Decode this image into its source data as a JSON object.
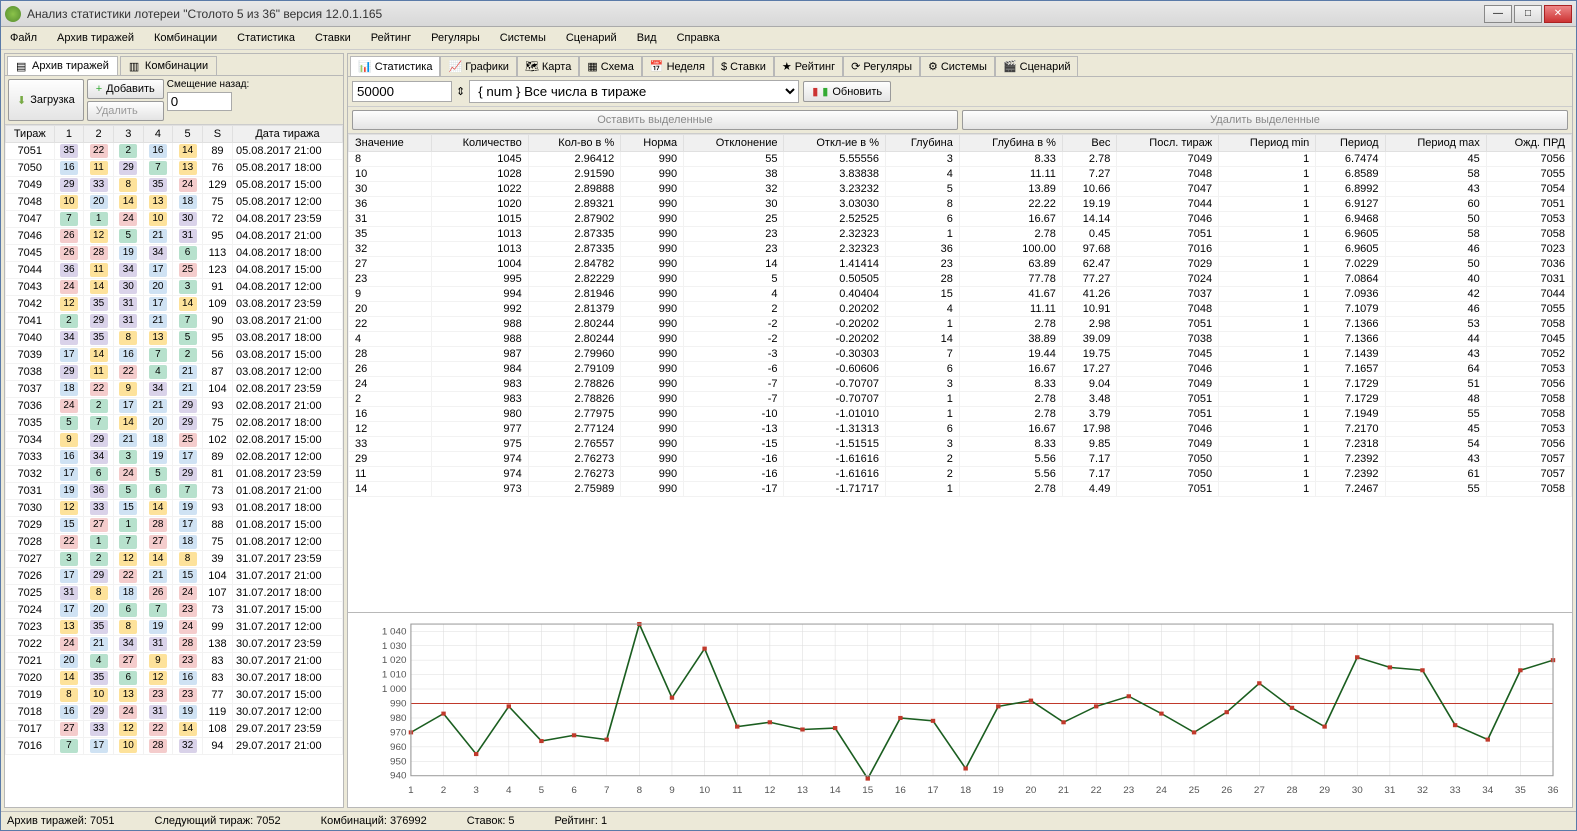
{
  "window": {
    "title": "Анализ статистики лотереи \"Столото 5 из 36\" версия 12.0.1.165"
  },
  "menu": [
    "Файл",
    "Архив тиражей",
    "Комбинации",
    "Статистика",
    "Ставки",
    "Рейтинг",
    "Регуляры",
    "Системы",
    "Сценарий",
    "Вид",
    "Справка"
  ],
  "leftTabs": {
    "archive": "Архив тиражей",
    "comb": "Комбинации"
  },
  "leftToolbar": {
    "load": "Загрузка",
    "add": "Добавить",
    "delete": "Удалить",
    "offsetLabel": "Смещение назад:",
    "offset": "0"
  },
  "archiveHeaders": [
    "Тираж",
    "1",
    "2",
    "3",
    "4",
    "5",
    "S",
    "Дата тиража"
  ],
  "archive": [
    {
      "t": 7051,
      "n": [
        35,
        22,
        2,
        16,
        14
      ],
      "s": 89,
      "d": "05.08.2017 21:00"
    },
    {
      "t": 7050,
      "n": [
        16,
        11,
        29,
        7,
        13
      ],
      "s": 76,
      "d": "05.08.2017 18:00"
    },
    {
      "t": 7049,
      "n": [
        29,
        33,
        8,
        35,
        24
      ],
      "s": 129,
      "d": "05.08.2017 15:00"
    },
    {
      "t": 7048,
      "n": [
        10,
        20,
        14,
        13,
        18
      ],
      "s": 75,
      "d": "05.08.2017 12:00"
    },
    {
      "t": 7047,
      "n": [
        7,
        1,
        24,
        10,
        30
      ],
      "s": 72,
      "d": "04.08.2017 23:59"
    },
    {
      "t": 7046,
      "n": [
        26,
        12,
        5,
        21,
        31
      ],
      "s": 95,
      "d": "04.08.2017 21:00"
    },
    {
      "t": 7045,
      "n": [
        26,
        28,
        19,
        34,
        6
      ],
      "s": 113,
      "d": "04.08.2017 18:00"
    },
    {
      "t": 7044,
      "n": [
        36,
        11,
        34,
        17,
        25
      ],
      "s": 123,
      "d": "04.08.2017 15:00"
    },
    {
      "t": 7043,
      "n": [
        24,
        14,
        30,
        20,
        3
      ],
      "s": 91,
      "d": "04.08.2017 12:00"
    },
    {
      "t": 7042,
      "n": [
        12,
        35,
        31,
        17,
        14
      ],
      "s": 109,
      "d": "03.08.2017 23:59"
    },
    {
      "t": 7041,
      "n": [
        2,
        29,
        31,
        21,
        7
      ],
      "s": 90,
      "d": "03.08.2017 21:00"
    },
    {
      "t": 7040,
      "n": [
        34,
        35,
        8,
        13,
        5
      ],
      "s": 95,
      "d": "03.08.2017 18:00"
    },
    {
      "t": 7039,
      "n": [
        17,
        14,
        16,
        7,
        2
      ],
      "s": 56,
      "d": "03.08.2017 15:00"
    },
    {
      "t": 7038,
      "n": [
        29,
        11,
        22,
        4,
        21
      ],
      "s": 87,
      "d": "03.08.2017 12:00"
    },
    {
      "t": 7037,
      "n": [
        18,
        22,
        9,
        34,
        21
      ],
      "s": 104,
      "d": "02.08.2017 23:59"
    },
    {
      "t": 7036,
      "n": [
        24,
        2,
        17,
        21,
        29
      ],
      "s": 93,
      "d": "02.08.2017 21:00"
    },
    {
      "t": 7035,
      "n": [
        5,
        7,
        14,
        20,
        29
      ],
      "s": 75,
      "d": "02.08.2017 18:00"
    },
    {
      "t": 7034,
      "n": [
        9,
        29,
        21,
        18,
        25
      ],
      "s": 102,
      "d": "02.08.2017 15:00"
    },
    {
      "t": 7033,
      "n": [
        16,
        34,
        3,
        19,
        17
      ],
      "s": 89,
      "d": "02.08.2017 12:00"
    },
    {
      "t": 7032,
      "n": [
        17,
        6,
        24,
        5,
        29
      ],
      "s": 81,
      "d": "01.08.2017 23:59"
    },
    {
      "t": 7031,
      "n": [
        19,
        36,
        5,
        6,
        7
      ],
      "s": 73,
      "d": "01.08.2017 21:00"
    },
    {
      "t": 7030,
      "n": [
        12,
        33,
        15,
        14,
        19
      ],
      "s": 93,
      "d": "01.08.2017 18:00"
    },
    {
      "t": 7029,
      "n": [
        15,
        27,
        1,
        28,
        17
      ],
      "s": 88,
      "d": "01.08.2017 15:00"
    },
    {
      "t": 7028,
      "n": [
        22,
        1,
        7,
        27,
        18
      ],
      "s": 75,
      "d": "01.08.2017 12:00"
    },
    {
      "t": 7027,
      "n": [
        3,
        2,
        12,
        14,
        8
      ],
      "s": 39,
      "d": "31.07.2017 23:59"
    },
    {
      "t": 7026,
      "n": [
        17,
        29,
        22,
        21,
        15
      ],
      "s": 104,
      "d": "31.07.2017 21:00"
    },
    {
      "t": 7025,
      "n": [
        31,
        8,
        18,
        26,
        24
      ],
      "s": 107,
      "d": "31.07.2017 18:00"
    },
    {
      "t": 7024,
      "n": [
        17,
        20,
        6,
        7,
        23
      ],
      "s": 73,
      "d": "31.07.2017 15:00"
    },
    {
      "t": 7023,
      "n": [
        13,
        35,
        8,
        19,
        24
      ],
      "s": 99,
      "d": "31.07.2017 12:00"
    },
    {
      "t": 7022,
      "n": [
        24,
        21,
        34,
        31,
        28
      ],
      "s": 138,
      "d": "30.07.2017 23:59"
    },
    {
      "t": 7021,
      "n": [
        20,
        4,
        27,
        9,
        23
      ],
      "s": 83,
      "d": "30.07.2017 21:00"
    },
    {
      "t": 7020,
      "n": [
        14,
        35,
        6,
        12,
        16
      ],
      "s": 83,
      "d": "30.07.2017 18:00"
    },
    {
      "t": 7019,
      "n": [
        8,
        10,
        13,
        23,
        23
      ],
      "s": 77,
      "d": "30.07.2017 15:00"
    },
    {
      "t": 7018,
      "n": [
        16,
        29,
        24,
        31,
        19
      ],
      "s": 119,
      "d": "30.07.2017 12:00"
    },
    {
      "t": 7017,
      "n": [
        27,
        33,
        12,
        22,
        14
      ],
      "s": 108,
      "d": "29.07.2017 23:59"
    },
    {
      "t": 7016,
      "n": [
        7,
        17,
        10,
        28,
        32
      ],
      "s": 94,
      "d": "29.07.2017 21:00"
    }
  ],
  "rightTabs": [
    "Статистика",
    "Графики",
    "Карта",
    "Схема",
    "Неделя",
    "Ставки",
    "Рейтинг",
    "Регуляры",
    "Системы",
    "Сценарий"
  ],
  "statToolbar": {
    "spin": "50000",
    "combo": "{ num } Все числа в тираже",
    "refresh": "Обновить",
    "keep": "Оставить выделенные",
    "del": "Удалить выделенные"
  },
  "statHeaders": [
    "Значение",
    "Количество",
    "Кол-во в %",
    "Норма",
    "Отклонение",
    "Откл-ие в %",
    "Глубина",
    "Глубина в %",
    "Вес",
    "Посл. тираж",
    "Период min",
    "Период",
    "Период max",
    "Ожд. ПРД"
  ],
  "stats": [
    {
      "v": 8,
      "c": 1045,
      "p": "2.96412",
      "n": 990,
      "d": 55,
      "dp": "5.55556",
      "g": 3,
      "gp": "8.33",
      "w": "2.78",
      "lt": 7049,
      "pmin": 1,
      "per": "6.7474",
      "pmax": 45,
      "eprd": 7056
    },
    {
      "v": 10,
      "c": 1028,
      "p": "2.91590",
      "n": 990,
      "d": 38,
      "dp": "3.83838",
      "g": 4,
      "gp": "11.11",
      "w": "7.27",
      "lt": 7048,
      "pmin": 1,
      "per": "6.8589",
      "pmax": 58,
      "eprd": 7055
    },
    {
      "v": 30,
      "c": 1022,
      "p": "2.89888",
      "n": 990,
      "d": 32,
      "dp": "3.23232",
      "g": 5,
      "gp": "13.89",
      "w": "10.66",
      "lt": 7047,
      "pmin": 1,
      "per": "6.8992",
      "pmax": 43,
      "eprd": 7054
    },
    {
      "v": 36,
      "c": 1020,
      "p": "2.89321",
      "n": 990,
      "d": 30,
      "dp": "3.03030",
      "g": 8,
      "gp": "22.22",
      "w": "19.19",
      "lt": 7044,
      "pmin": 1,
      "per": "6.9127",
      "pmax": 60,
      "eprd": 7051
    },
    {
      "v": 31,
      "c": 1015,
      "p": "2.87902",
      "n": 990,
      "d": 25,
      "dp": "2.52525",
      "g": 6,
      "gp": "16.67",
      "w": "14.14",
      "lt": 7046,
      "pmin": 1,
      "per": "6.9468",
      "pmax": 50,
      "eprd": 7053
    },
    {
      "v": 35,
      "c": 1013,
      "p": "2.87335",
      "n": 990,
      "d": 23,
      "dp": "2.32323",
      "g": 1,
      "gp": "2.78",
      "w": "0.45",
      "lt": 7051,
      "pmin": 1,
      "per": "6.9605",
      "pmax": 58,
      "eprd": 7058
    },
    {
      "v": 32,
      "c": 1013,
      "p": "2.87335",
      "n": 990,
      "d": 23,
      "dp": "2.32323",
      "g": 36,
      "gp": "100.00",
      "w": "97.68",
      "lt": 7016,
      "pmin": 1,
      "per": "6.9605",
      "pmax": 46,
      "eprd": 7023
    },
    {
      "v": 27,
      "c": 1004,
      "p": "2.84782",
      "n": 990,
      "d": 14,
      "dp": "1.41414",
      "g": 23,
      "gp": "63.89",
      "w": "62.47",
      "lt": 7029,
      "pmin": 1,
      "per": "7.0229",
      "pmax": 50,
      "eprd": 7036
    },
    {
      "v": 23,
      "c": 995,
      "p": "2.82229",
      "n": 990,
      "d": 5,
      "dp": "0.50505",
      "g": 28,
      "gp": "77.78",
      "w": "77.27",
      "lt": 7024,
      "pmin": 1,
      "per": "7.0864",
      "pmax": 40,
      "eprd": 7031
    },
    {
      "v": 9,
      "c": 994,
      "p": "2.81946",
      "n": 990,
      "d": 4,
      "dp": "0.40404",
      "g": 15,
      "gp": "41.67",
      "w": "41.26",
      "lt": 7037,
      "pmin": 1,
      "per": "7.0936",
      "pmax": 42,
      "eprd": 7044
    },
    {
      "v": 20,
      "c": 992,
      "p": "2.81379",
      "n": 990,
      "d": 2,
      "dp": "0.20202",
      "g": 4,
      "gp": "11.11",
      "w": "10.91",
      "lt": 7048,
      "pmin": 1,
      "per": "7.1079",
      "pmax": 46,
      "eprd": 7055
    },
    {
      "v": 22,
      "c": 988,
      "p": "2.80244",
      "n": 990,
      "d": -2,
      "dp": "-0.20202",
      "g": 1,
      "gp": "2.78",
      "w": "2.98",
      "lt": 7051,
      "pmin": 1,
      "per": "7.1366",
      "pmax": 53,
      "eprd": 7058
    },
    {
      "v": 4,
      "c": 988,
      "p": "2.80244",
      "n": 990,
      "d": -2,
      "dp": "-0.20202",
      "g": 14,
      "gp": "38.89",
      "w": "39.09",
      "lt": 7038,
      "pmin": 1,
      "per": "7.1366",
      "pmax": 44,
      "eprd": 7045
    },
    {
      "v": 28,
      "c": 987,
      "p": "2.79960",
      "n": 990,
      "d": -3,
      "dp": "-0.30303",
      "g": 7,
      "gp": "19.44",
      "w": "19.75",
      "lt": 7045,
      "pmin": 1,
      "per": "7.1439",
      "pmax": 43,
      "eprd": 7052
    },
    {
      "v": 26,
      "c": 984,
      "p": "2.79109",
      "n": 990,
      "d": -6,
      "dp": "-0.60606",
      "g": 6,
      "gp": "16.67",
      "w": "17.27",
      "lt": 7046,
      "pmin": 1,
      "per": "7.1657",
      "pmax": 64,
      "eprd": 7053
    },
    {
      "v": 24,
      "c": 983,
      "p": "2.78826",
      "n": 990,
      "d": -7,
      "dp": "-0.70707",
      "g": 3,
      "gp": "8.33",
      "w": "9.04",
      "lt": 7049,
      "pmin": 1,
      "per": "7.1729",
      "pmax": 51,
      "eprd": 7056
    },
    {
      "v": 2,
      "c": 983,
      "p": "2.78826",
      "n": 990,
      "d": -7,
      "dp": "-0.70707",
      "g": 1,
      "gp": "2.78",
      "w": "3.48",
      "lt": 7051,
      "pmin": 1,
      "per": "7.1729",
      "pmax": 48,
      "eprd": 7058
    },
    {
      "v": 16,
      "c": 980,
      "p": "2.77975",
      "n": 990,
      "d": -10,
      "dp": "-1.01010",
      "g": 1,
      "gp": "2.78",
      "w": "3.79",
      "lt": 7051,
      "pmin": 1,
      "per": "7.1949",
      "pmax": 55,
      "eprd": 7058
    },
    {
      "v": 12,
      "c": 977,
      "p": "2.77124",
      "n": 990,
      "d": -13,
      "dp": "-1.31313",
      "g": 6,
      "gp": "16.67",
      "w": "17.98",
      "lt": 7046,
      "pmin": 1,
      "per": "7.2170",
      "pmax": 45,
      "eprd": 7053
    },
    {
      "v": 33,
      "c": 975,
      "p": "2.76557",
      "n": 990,
      "d": -15,
      "dp": "-1.51515",
      "g": 3,
      "gp": "8.33",
      "w": "9.85",
      "lt": 7049,
      "pmin": 1,
      "per": "7.2318",
      "pmax": 54,
      "eprd": 7056
    },
    {
      "v": 29,
      "c": 974,
      "p": "2.76273",
      "n": 990,
      "d": -16,
      "dp": "-1.61616",
      "g": 2,
      "gp": "5.56",
      "w": "7.17",
      "lt": 7050,
      "pmin": 1,
      "per": "7.2392",
      "pmax": 43,
      "eprd": 7057
    },
    {
      "v": 11,
      "c": 974,
      "p": "2.76273",
      "n": 990,
      "d": -16,
      "dp": "-1.61616",
      "g": 2,
      "gp": "5.56",
      "w": "7.17",
      "lt": 7050,
      "pmin": 1,
      "per": "7.2392",
      "pmax": 61,
      "eprd": 7057
    },
    {
      "v": 14,
      "c": 973,
      "p": "2.75989",
      "n": 990,
      "d": -17,
      "dp": "-1.71717",
      "g": 1,
      "gp": "2.78",
      "w": "4.49",
      "lt": 7051,
      "pmin": 1,
      "per": "7.2467",
      "pmax": 55,
      "eprd": 7058
    }
  ],
  "status": {
    "archive": "Архив тиражей: 7051",
    "next": "Следующий тираж: 7052",
    "comb": "Комбинаций: 376992",
    "bets": "Ставок: 5",
    "rating": "Рейтинг: 1"
  },
  "chart_data": {
    "type": "line",
    "categories": [
      1,
      2,
      3,
      4,
      5,
      6,
      7,
      8,
      9,
      10,
      11,
      12,
      13,
      14,
      15,
      16,
      17,
      18,
      19,
      20,
      21,
      22,
      23,
      24,
      25,
      26,
      27,
      28,
      29,
      30,
      31,
      32,
      33,
      34,
      35,
      36
    ],
    "values": [
      970,
      983,
      955,
      988,
      964,
      968,
      965,
      1045,
      994,
      1028,
      974,
      977,
      972,
      973,
      938,
      980,
      978,
      945,
      988,
      992,
      977,
      988,
      995,
      983,
      970,
      984,
      1004,
      987,
      974,
      1022,
      1015,
      1013,
      975,
      965,
      1013,
      1020
    ],
    "norm": 990,
    "ylim": [
      940,
      1045
    ],
    "ylabel": "",
    "xlabel": "",
    "title": ""
  },
  "numberColors": {
    "1": "#b7e1cd",
    "2": "#b7e1cd",
    "3": "#b7e1cd",
    "4": "#b7e1cd",
    "5": "#b7e1cd",
    "6": "#b7e1cd",
    "7": "#b7e1cd",
    "8": "#fde29b",
    "9": "#fde29b",
    "10": "#fde29b",
    "11": "#fde29b",
    "12": "#fde29b",
    "13": "#fde29b",
    "14": "#fde29b",
    "15": "#cfe2f3",
    "16": "#cfe2f3",
    "17": "#cfe2f3",
    "18": "#cfe2f3",
    "19": "#cfe2f3",
    "20": "#cfe2f3",
    "21": "#cfe2f3",
    "22": "#f4cccc",
    "23": "#f4cccc",
    "24": "#f4cccc",
    "25": "#f4cccc",
    "26": "#f4cccc",
    "27": "#f4cccc",
    "28": "#f4cccc",
    "29": "#d9d2e9",
    "30": "#d9d2e9",
    "31": "#d9d2e9",
    "32": "#d9d2e9",
    "33": "#d9d2e9",
    "34": "#d9d2e9",
    "35": "#d9d2e9",
    "36": "#d9d2e9"
  }
}
